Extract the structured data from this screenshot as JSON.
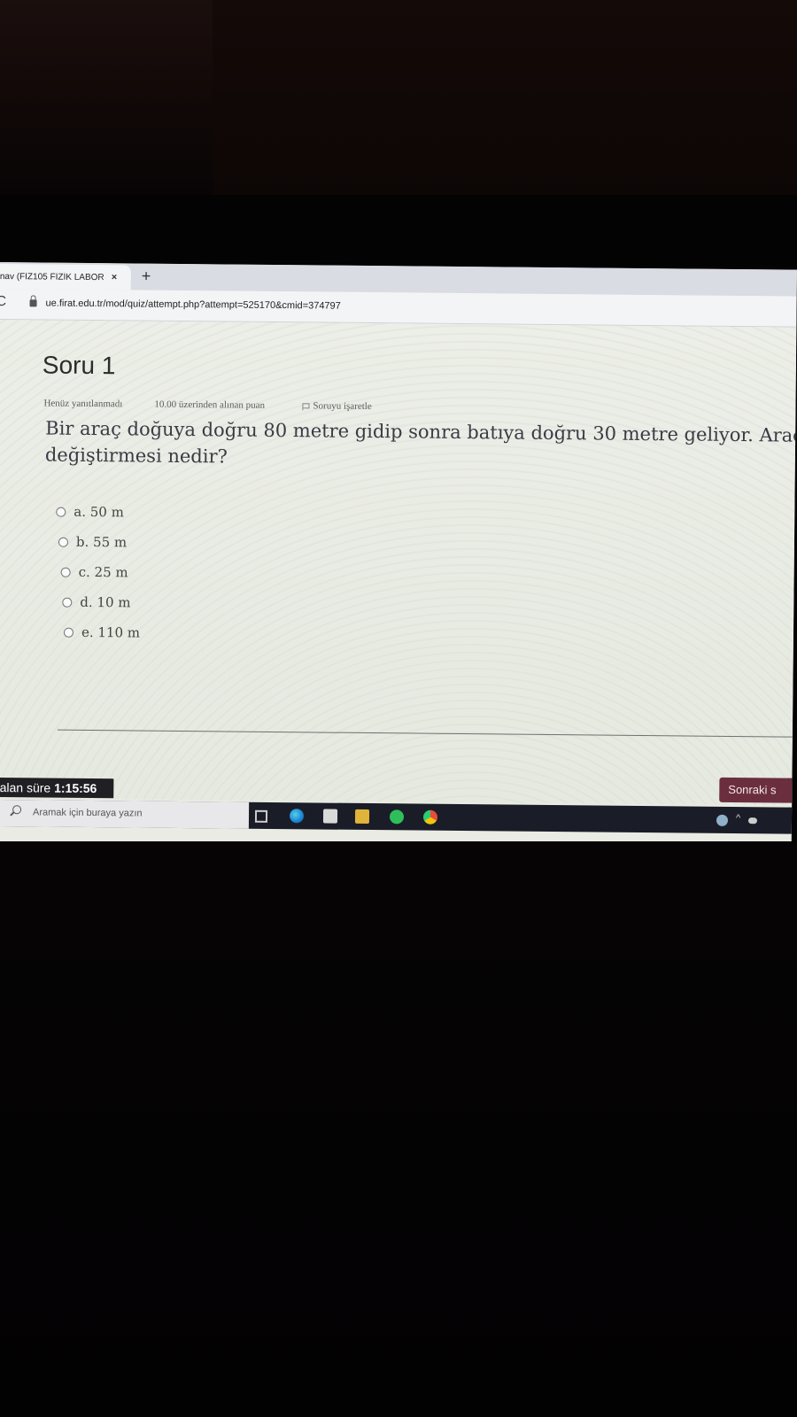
{
  "browser": {
    "tab_title": "nav (FİZ105 FİZİK LABOR",
    "tab_close": "×",
    "new_tab": "+",
    "reload": "C",
    "url": "ue.firat.edu.tr/mod/quiz/attempt.php?attempt=525170&cmid=374797"
  },
  "question": {
    "title": "Soru 1",
    "status": "Henüz yanıtlanmadı",
    "points": "10.00 üzerinden alınan puan",
    "flag_label": "Soruyu işaretle",
    "text_line1": "Bir araç doğuya doğru 80 metre gidip sonra batıya doğru 30 metre geliyor. Aracın topla",
    "text_line2": "değiştirmesi nedir?",
    "options": [
      {
        "label": "a. 50 m"
      },
      {
        "label": "b. 55 m"
      },
      {
        "label": "c. 25 m"
      },
      {
        "label": "d. 10 m"
      },
      {
        "label": "e. 110 m"
      }
    ]
  },
  "footer": {
    "timer_label": "Kalan süre",
    "timer_value": "1:15:56",
    "next_button": "Sonraki s"
  },
  "taskbar": {
    "search_placeholder": "Aramak için buraya yazın",
    "icons": [
      "task-view-icon",
      "edge-icon",
      "store-icon",
      "file-explorer-icon",
      "spotify-icon",
      "chrome-icon"
    ],
    "tray_chevron": "^"
  }
}
